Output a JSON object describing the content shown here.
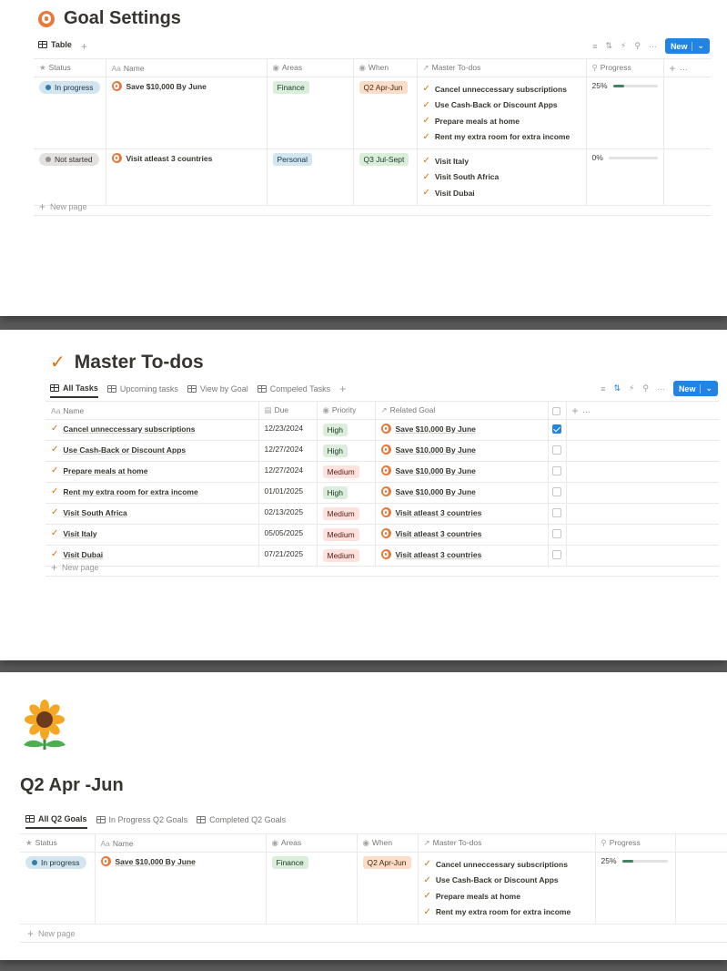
{
  "colors": {
    "accent": "#2383e2",
    "brand_orange": "#d9730d",
    "status_in_progress_bg": "#d3e5ef",
    "status_in_progress_dot": "#337ea9",
    "status_not_started_bg": "#e3e2e0",
    "status_not_started_dot": "#91918e",
    "tag_green_bg": "#dbeddb",
    "tag_green_text": "#1c3829",
    "tag_orange_bg": "#fadec9",
    "tag_orange_text": "#49290e",
    "tag_blue_bg": "#d3e5ef",
    "tag_blue_text": "#183347",
    "tag_red_bg": "#ffe2dd",
    "tag_red_text": "#5d1715"
  },
  "goal_settings": {
    "title": "Goal Settings",
    "title_icon": "target-icon",
    "views": [
      {
        "label": "Table",
        "active": true
      }
    ],
    "new_label": "New",
    "columns": {
      "status": "Status",
      "name": "Name",
      "areas": "Areas",
      "when": "When",
      "todos": "Master To-dos",
      "progress": "Progress"
    },
    "rows": [
      {
        "status": "In progress",
        "name": "Save $10,000 By June",
        "area": "Finance",
        "when": "Q2 Apr-Jun",
        "todos": [
          "Cancel unneccessary subscriptions",
          "Use Cash-Back or Discount Apps",
          "Prepare meals at home",
          "Rent my extra room for extra income"
        ],
        "progress_label": "25%",
        "progress_value": 0.25
      },
      {
        "status": "Not started",
        "name": "Visit atleast 3 countries",
        "area": "Personal",
        "when": "Q3 Jul-Sept",
        "todos": [
          "Visit Italy",
          "Visit South Africa",
          "Visit Dubai"
        ],
        "progress_label": "0%",
        "progress_value": 0
      }
    ],
    "new_page_label": "New page"
  },
  "master_todos": {
    "title": "Master To-dos",
    "views": [
      {
        "label": "All Tasks",
        "active": true
      },
      {
        "label": "Upcoming tasks",
        "active": false
      },
      {
        "label": "View by Goal",
        "active": false
      },
      {
        "label": "Compeled Tasks",
        "active": false
      }
    ],
    "new_label": "New",
    "columns": {
      "name": "Name",
      "due": "Due",
      "priority": "Priority",
      "goal": "Related Goal"
    },
    "rows": [
      {
        "name": "Cancel unneccessary subscriptions",
        "due": "12/23/2024",
        "priority": "High",
        "goal": "Save $10,000 By June",
        "done": true
      },
      {
        "name": "Use Cash-Back or Discount Apps",
        "due": "12/27/2024",
        "priority": "High",
        "goal": "Save $10,000 By June",
        "done": false
      },
      {
        "name": "Prepare meals at home",
        "due": "12/27/2024",
        "priority": "Medium",
        "goal": "Save $10,000 By June",
        "done": false
      },
      {
        "name": "Rent my extra room for extra income",
        "due": "01/01/2025",
        "priority": "High",
        "goal": "Save $10,000 By June",
        "done": false
      },
      {
        "name": "Visit South Africa",
        "due": "02/13/2025",
        "priority": "Medium",
        "goal": "Visit atleast 3 countries",
        "done": false
      },
      {
        "name": "Visit Italy",
        "due": "05/05/2025",
        "priority": "Medium",
        "goal": "Visit atleast 3 countries",
        "done": false
      },
      {
        "name": "Visit Dubai",
        "due": "07/21/2025",
        "priority": "Medium",
        "goal": "Visit atleast 3 countries",
        "done": false
      }
    ],
    "new_page_label": "New page"
  },
  "q2": {
    "page_icon": "sunflower-icon",
    "title": "Q2 Apr -Jun",
    "views": [
      {
        "label": "All Q2 Goals",
        "active": true
      },
      {
        "label": "In Progress Q2 Goals",
        "active": false
      },
      {
        "label": "Completed Q2 Goals",
        "active": false
      }
    ],
    "columns": {
      "status": "Status",
      "name": "Name",
      "areas": "Areas",
      "when": "When",
      "todos": "Master To-dos",
      "progress": "Progress"
    },
    "rows": [
      {
        "status": "In progress",
        "name": "Save $10,000 By June",
        "area": "Finance",
        "when": "Q2 Apr-Jun",
        "todos": [
          "Cancel unneccessary subscriptions",
          "Use Cash-Back or Discount Apps",
          "Prepare meals at home",
          "Rent my extra room for extra income"
        ],
        "progress_label": "25%",
        "progress_value": 0.25
      }
    ],
    "new_page_label": "New page"
  }
}
